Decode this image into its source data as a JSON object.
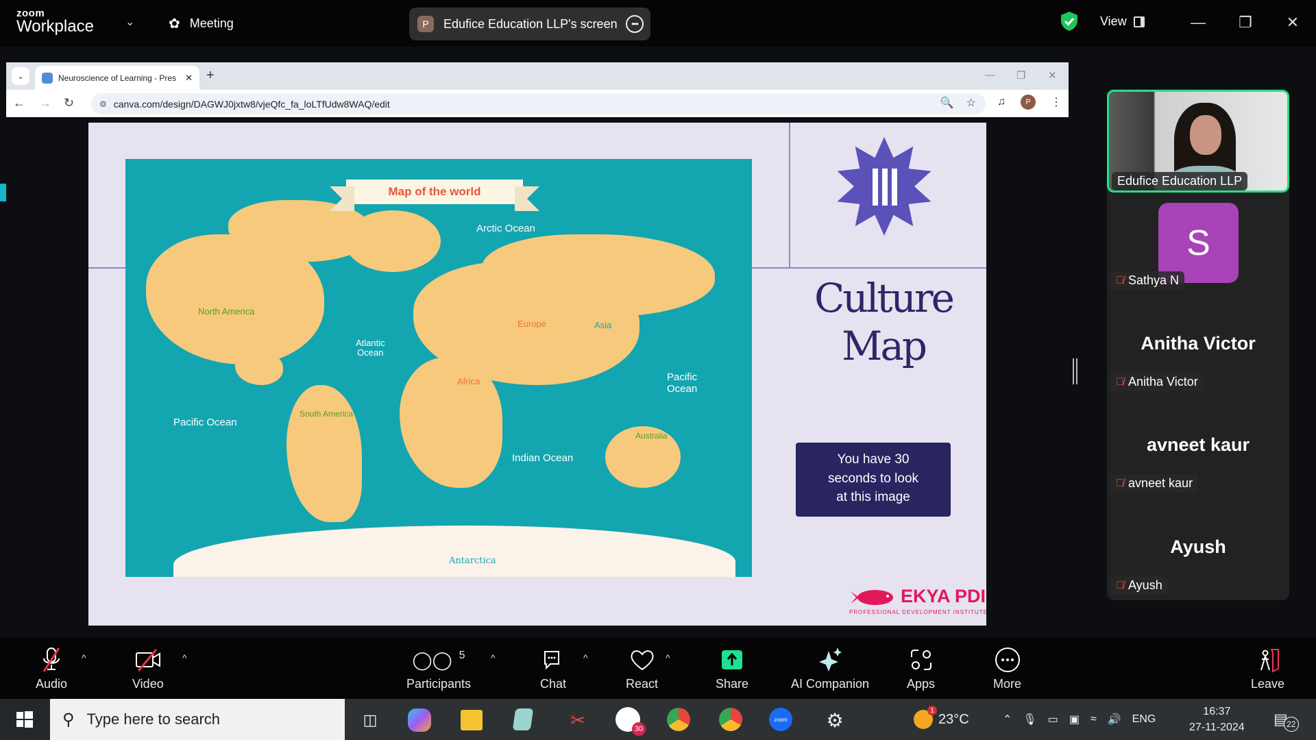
{
  "zoom": {
    "brand_small": "zoom",
    "brand_big": "Workplace",
    "meeting_label": "Meeting",
    "share_initial": "P",
    "share_label": "Edufice Education LLP's screen",
    "view_label": "View",
    "colors": {
      "accent_green": "#24e082",
      "shield": "#1fc65a",
      "share": "#1ee08f",
      "muted": "#e84b4b"
    }
  },
  "browser": {
    "tab_title": "Neuroscience of Learning - Pres",
    "url": "canva.com/design/DAGWJ0jxtw8/vjeQfc_fa_loLTfUdw8WAQ/edit",
    "profile_initial": "P"
  },
  "slide": {
    "map_title": "Map of the world",
    "map_labels": {
      "arctic": "Arctic Ocean",
      "atlantic_1": "Atlantic",
      "atlantic_2": "Ocean",
      "pacific_left": "Pacific Ocean",
      "pacific_right_1": "Pacific",
      "pacific_right_2": "Ocean",
      "indian": "Indian Ocean",
      "north_america": "North America",
      "south_america": "South America",
      "europe": "Europe",
      "asia": "Asia",
      "africa": "Africa",
      "australia": "Australia",
      "antarctica": "Antarctica"
    },
    "badge_numeral": "III",
    "title_line1": "Culture",
    "title_line2": "Map",
    "info_line1": "You have 30",
    "info_line2": "seconds to look",
    "info_line3": "at this image",
    "logo_text": "EKYA PDI",
    "logo_sub": "PROFESSIONAL DEVELOPMENT INSTITUTE"
  },
  "participants": [
    {
      "name": "Edufice Education LLP",
      "video": true
    },
    {
      "name": "Sathya N",
      "initial": "S",
      "muted": true
    },
    {
      "name": "Anitha Victor",
      "muted": true
    },
    {
      "name": "avneet kaur",
      "muted": true
    },
    {
      "name": "Ayush",
      "muted": true
    }
  ],
  "toolbar": {
    "audio": "Audio",
    "video": "Video",
    "participants": "Participants",
    "participant_count": "5",
    "chat": "Chat",
    "react": "React",
    "share": "Share",
    "ai": "AI Companion",
    "apps": "Apps",
    "more": "More",
    "leave": "Leave"
  },
  "taskbar": {
    "search_placeholder": "Type here to search",
    "slack_badge": "30",
    "weather_badge": "1",
    "temperature": "23°C",
    "language": "ENG",
    "time": "16:37",
    "date": "27-11-2024",
    "notifications": "22"
  }
}
